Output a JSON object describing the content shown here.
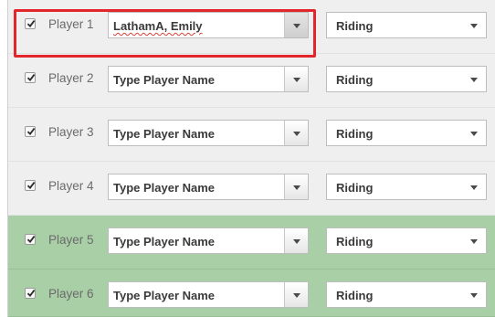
{
  "players": [
    {
      "label": "Player 1",
      "name": "LathamA,  Emily",
      "is_placeholder": false,
      "checked": true,
      "category": "Riding",
      "row_color": "gray",
      "selected": true
    },
    {
      "label": "Player 2",
      "name": "Type Player Name",
      "is_placeholder": true,
      "checked": true,
      "category": "Riding",
      "row_color": "gray",
      "selected": false
    },
    {
      "label": "Player 3",
      "name": "Type Player Name",
      "is_placeholder": true,
      "checked": true,
      "category": "Riding",
      "row_color": "gray",
      "selected": false
    },
    {
      "label": "Player 4",
      "name": "Type Player Name",
      "is_placeholder": true,
      "checked": true,
      "category": "Riding",
      "row_color": "gray",
      "selected": false
    },
    {
      "label": "Player 5",
      "name": "Type Player Name",
      "is_placeholder": true,
      "checked": true,
      "category": "Riding",
      "row_color": "green",
      "selected": false
    },
    {
      "label": "Player 6",
      "name": "Type Player Name",
      "is_placeholder": true,
      "checked": true,
      "category": "Riding",
      "row_color": "green",
      "selected": false
    }
  ],
  "colors": {
    "row_gray": "#efefef",
    "row_green": "#a9cfa7",
    "highlight": "#e3262c"
  },
  "icons": {
    "checkbox": "checkmark-icon",
    "dropdown": "chevron-down-icon"
  }
}
